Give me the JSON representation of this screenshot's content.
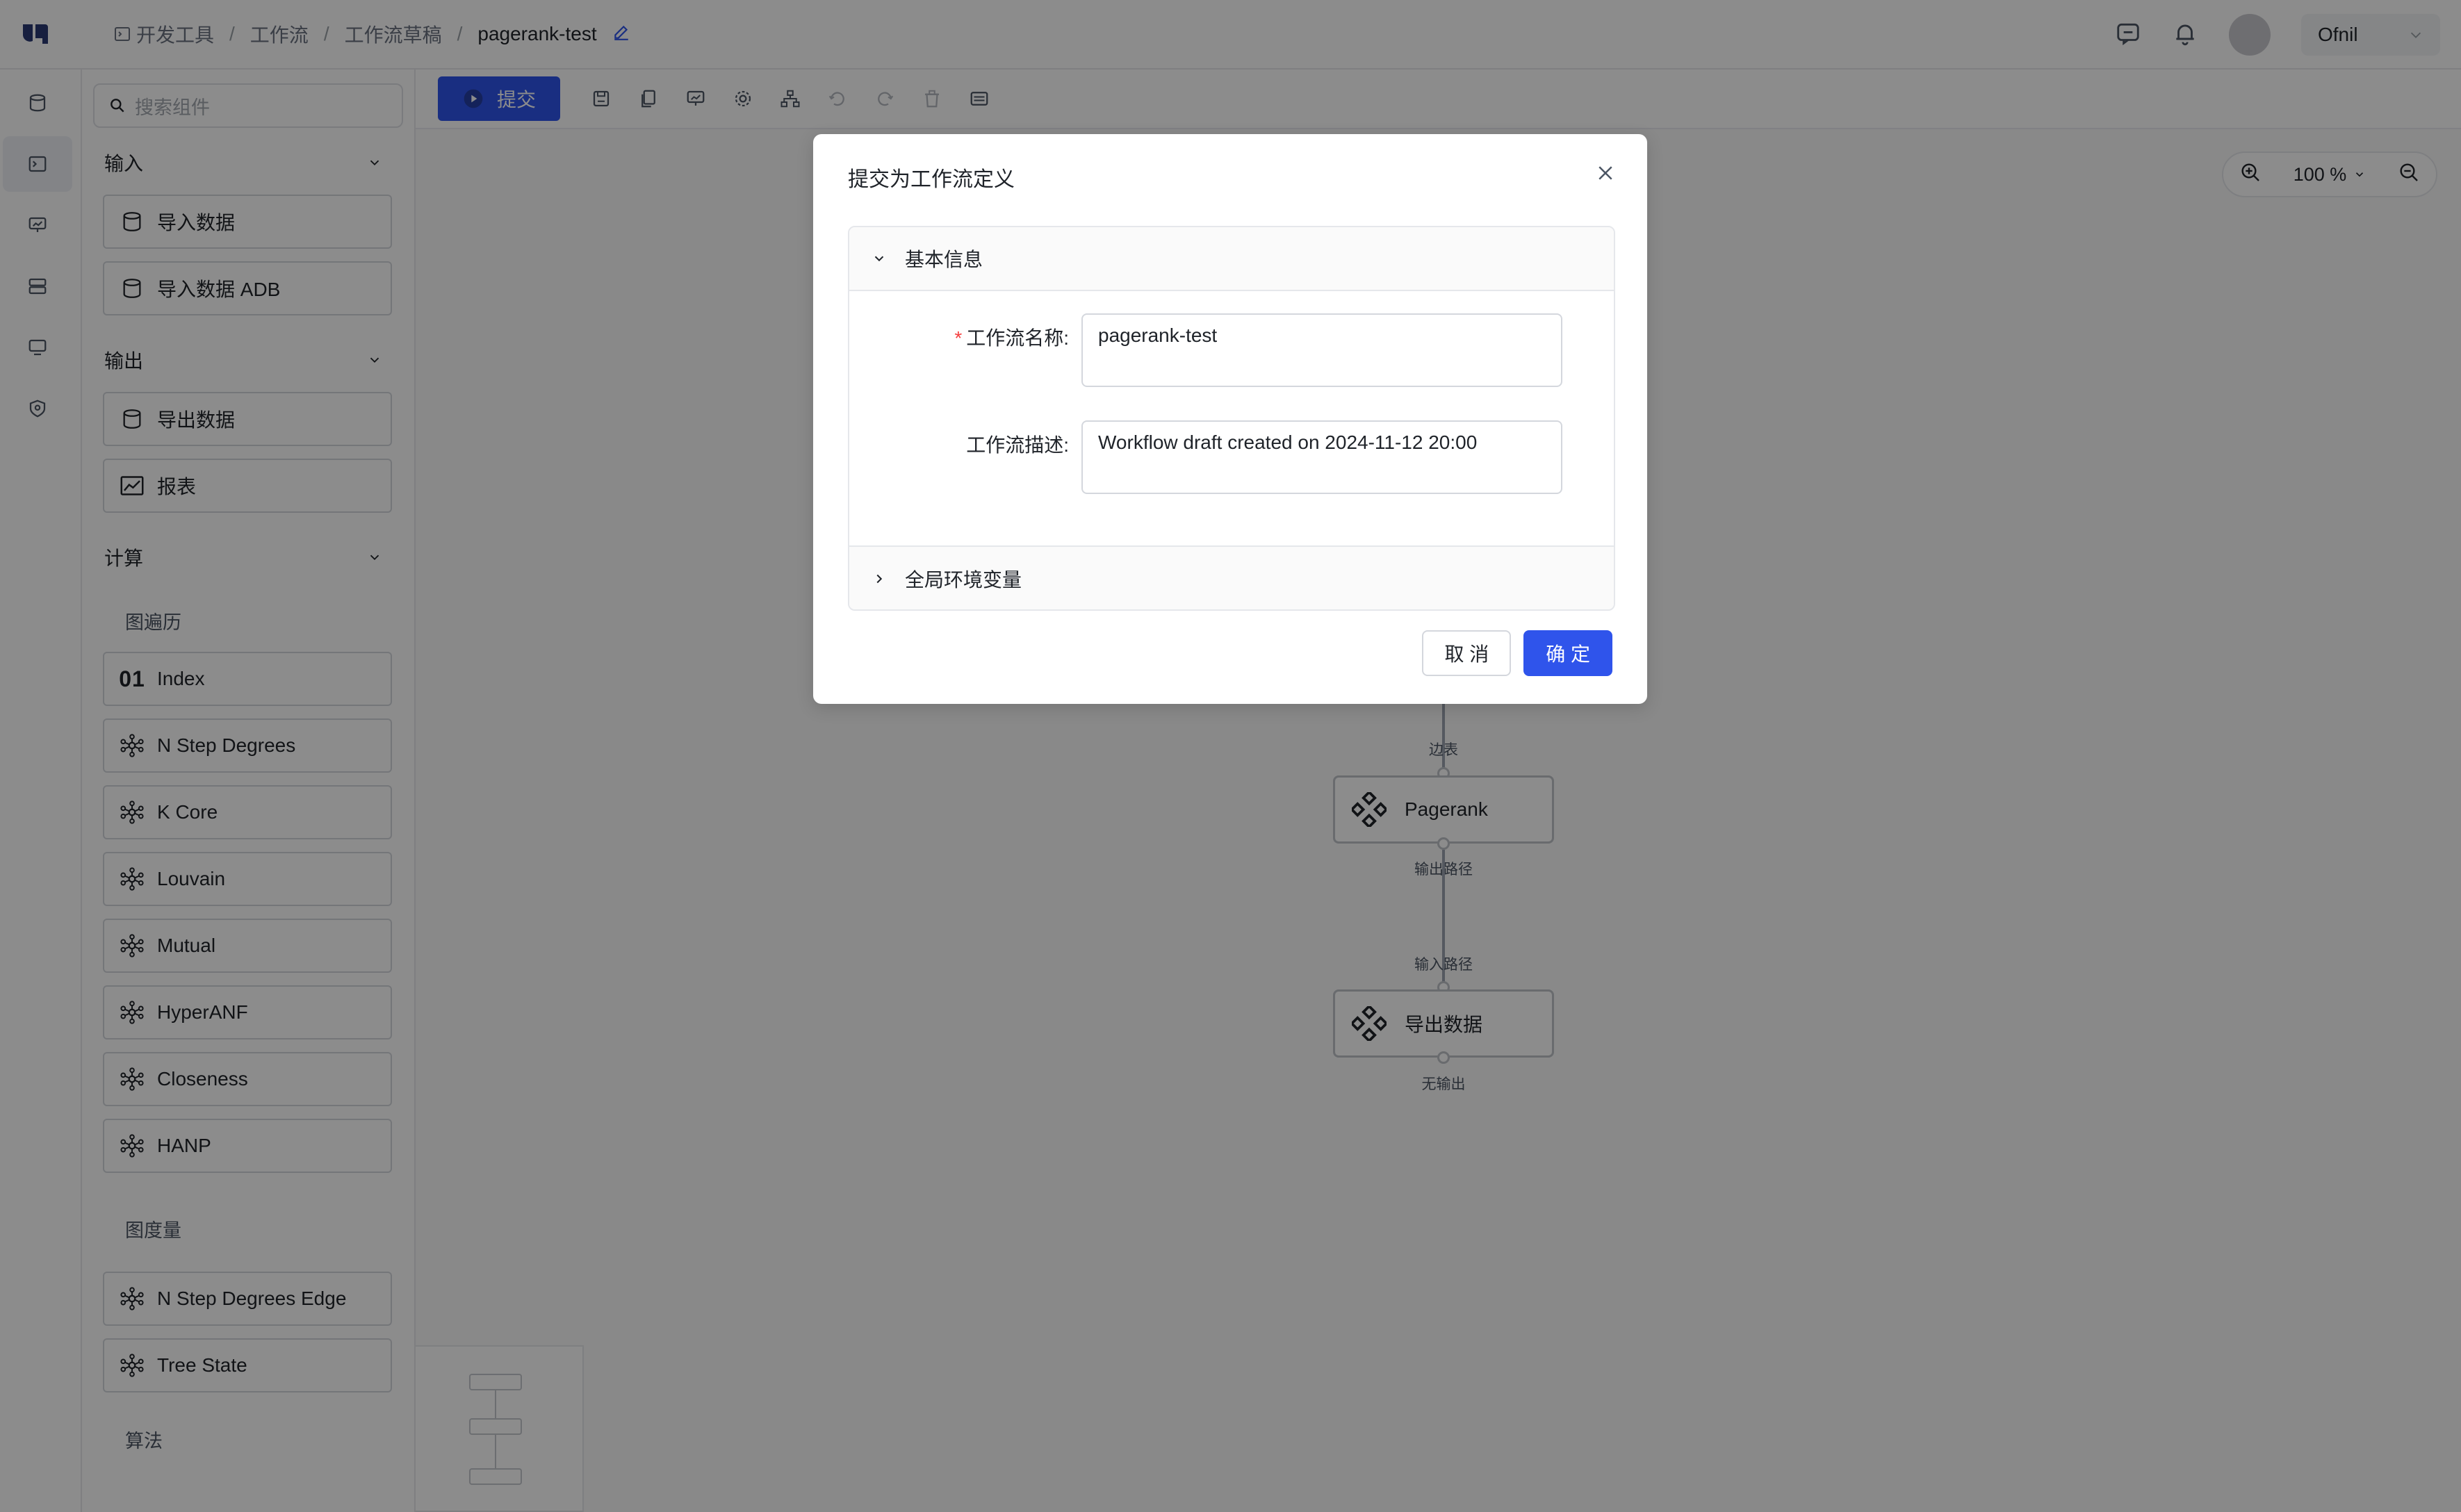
{
  "breadcrumb": {
    "items": [
      "开发工具",
      "工作流",
      "工作流草稿"
    ],
    "current": "pagerank-test",
    "sep": "/"
  },
  "user": {
    "name": "Ofnil"
  },
  "search": {
    "placeholder": "搜索组件"
  },
  "panel": {
    "groups": [
      {
        "title": "输入",
        "items": [
          "导入数据",
          "导入数据 ADB"
        ]
      },
      {
        "title": "输出",
        "items": [
          "导出数据",
          "报表"
        ]
      },
      {
        "title": "计算"
      }
    ],
    "subsections": [
      {
        "title": "图遍历",
        "items": [
          "Index",
          "N Step Degrees",
          "K Core",
          "Louvain",
          "Mutual",
          "HyperANF",
          "Closeness",
          "HANP"
        ]
      },
      {
        "title": "图度量",
        "items": [
          "N Step Degrees Edge",
          "Tree State"
        ]
      },
      {
        "title": "算法"
      }
    ],
    "index_icon_text": "01"
  },
  "toolbar": {
    "submit_label": "提交"
  },
  "zoom": {
    "level": "100 %"
  },
  "canvas": {
    "nodes": [
      {
        "label": "Pagerank"
      },
      {
        "label": "导出数据"
      }
    ],
    "edge_labels": [
      "边表",
      "输出路径",
      "输入路径",
      "无输出"
    ]
  },
  "modal": {
    "title": "提交为工作流定义",
    "section_basic": "基本信息",
    "name_label": "工作流名称:",
    "name_value": "pagerank-test",
    "desc_label": "工作流描述:",
    "desc_value": "Workflow draft created on 2024-11-12 20:00",
    "section_env": "全局环境变量",
    "cancel_label": "取 消",
    "ok_label": "确 定",
    "required_mark": "*"
  },
  "colors": {
    "primary": "#2f54eb",
    "required": "#f53f3f"
  }
}
